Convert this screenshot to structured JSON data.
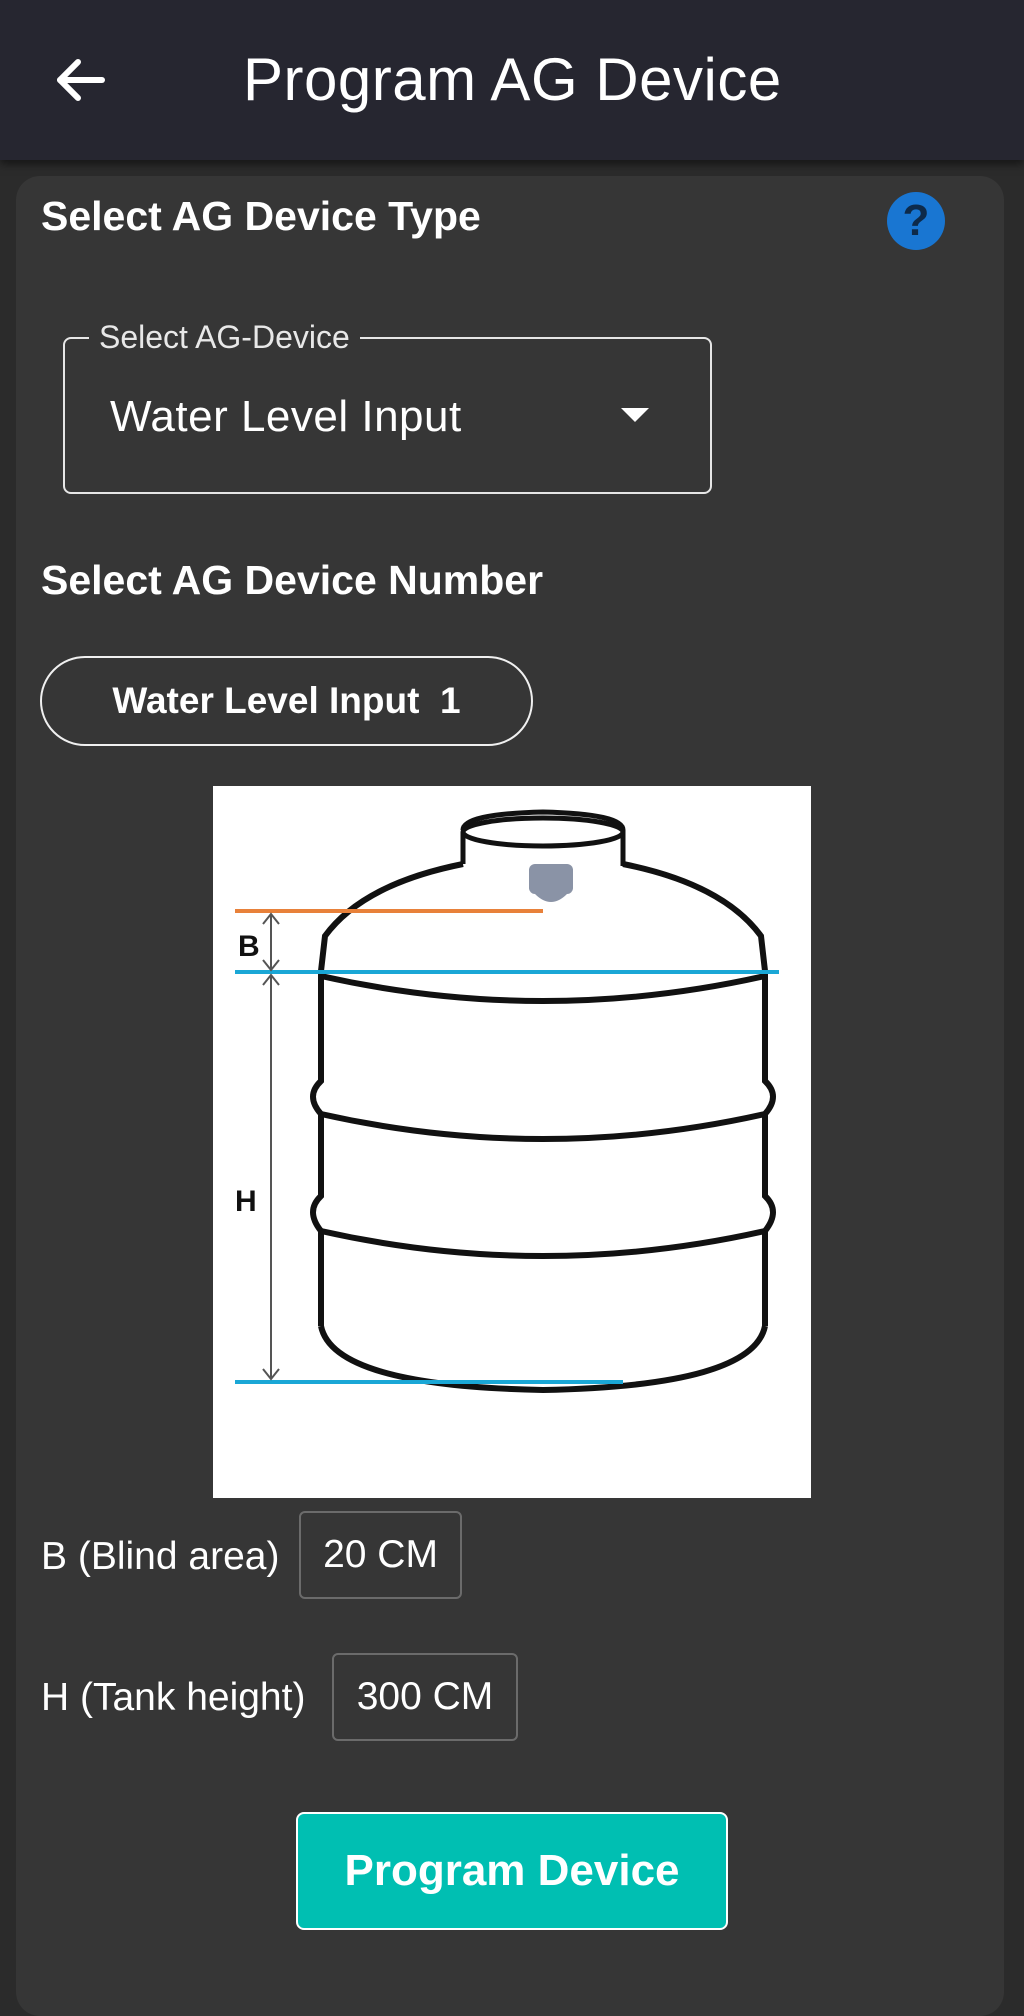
{
  "appbar": {
    "title": "Program AG Device",
    "back_icon": "arrow-left-icon"
  },
  "device_type": {
    "section_title": "Select AG Device Type",
    "help_icon": "help-circle-icon",
    "help_symbol": "?",
    "dropdown_label": "Select AG-Device",
    "dropdown_value": "Water Level Input",
    "dropdown_icon": "chevron-down-icon"
  },
  "device_number": {
    "section_title": "Select AG Device Number",
    "selected": "Water Level Input  1"
  },
  "diagram": {
    "label_b": "B",
    "label_h": "H"
  },
  "fields": {
    "blind_area_label": "B (Blind area)",
    "blind_area_value": "20 CM",
    "tank_height_label": "H (Tank height)",
    "tank_height_value": "300 CM"
  },
  "actions": {
    "program_label": "Program Device"
  },
  "colors": {
    "accent": "#00bfb2",
    "help": "#1976d2",
    "orange_line": "#e8813a",
    "blue_line": "#1aa7d6"
  }
}
